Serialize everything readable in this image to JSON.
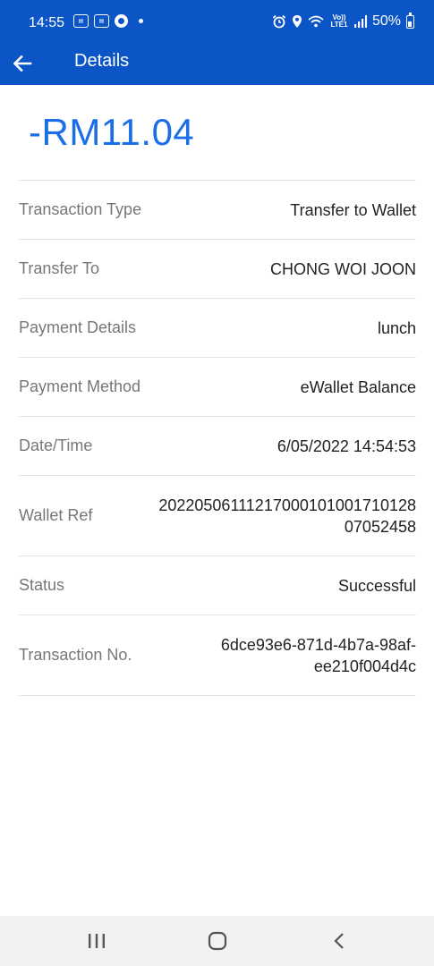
{
  "status_bar": {
    "time": "14:55",
    "left_icons": [
      "notification-app-icon",
      "notification-app-icon",
      "browser-icon"
    ],
    "lte_label": "Vo)) LTE1",
    "battery": "50%"
  },
  "app_bar": {
    "title": "Details"
  },
  "transaction": {
    "amount": "-RM11.04",
    "rows": [
      {
        "label": "Transaction Type",
        "value": [
          "Transfer to Wallet"
        ]
      },
      {
        "label": "Transfer To",
        "value": [
          "CHONG WOI JOON"
        ]
      },
      {
        "label": "Payment Details",
        "value": [
          "lunch"
        ]
      },
      {
        "label": "Payment Method",
        "value": [
          "eWallet Balance"
        ]
      },
      {
        "label": "Date/Time",
        "value": [
          "6/05/2022 14:54:53"
        ]
      },
      {
        "label": "Wallet Ref",
        "value": [
          "20220506111217000101001710128",
          "07052458"
        ]
      },
      {
        "label": "Status",
        "value": [
          "Successful"
        ]
      },
      {
        "label": "Transaction No.",
        "value": [
          "6dce93e6-871d-4b7a-98af-",
          "ee210f004d4c"
        ]
      }
    ]
  },
  "nav_bar": {
    "buttons": [
      "recent-apps-icon",
      "home-icon",
      "back-icon"
    ]
  },
  "colors": {
    "header": "#0b55c6",
    "amount": "#1a6ee8"
  }
}
